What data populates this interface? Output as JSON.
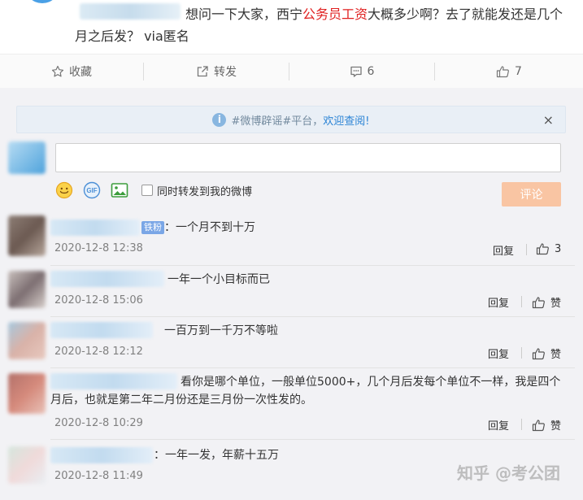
{
  "post": {
    "text_a": "想问一下大家，西宁",
    "text_red": "公务员工资",
    "text_b": "大概多少啊？去了就能发还是几个月之后发？ via匿名"
  },
  "actions": {
    "favorite": "收藏",
    "repost": "转发",
    "comment_count": "6",
    "like_count": "7"
  },
  "notice": {
    "hashtag": "#微博辟谣#平台，",
    "link": "欢迎查阅!",
    "close": "×"
  },
  "composer": {
    "placeholder": "",
    "sync_label": "同时转发到我的微博",
    "submit": "评论"
  },
  "comments": [
    {
      "badge": "铁粉",
      "text": "：一个月不到十万",
      "time": "2020-12-8 12:38",
      "reply": "回复",
      "like": "3"
    },
    {
      "text": "一年一个小目标而已",
      "time": "2020-12-8 15:06",
      "reply": "回复",
      "like": "赞"
    },
    {
      "text": "一百万到一千万不等啦",
      "time": "2020-12-8 12:12",
      "reply": "回复",
      "like": "赞"
    },
    {
      "text": "看你是哪个单位，一般单位5000+，几个月后发每个单位不一样，我是四个月后，也就是第二年二月份还是三月份一次性发的。",
      "time": "2020-12-8 10:29",
      "reply": "回复",
      "like": "赞"
    },
    {
      "text": "：一年一发，年薪十五万",
      "time": "2020-12-8 11:49",
      "reply": "",
      "like": ""
    }
  ],
  "watermark": "知乎 @考公团"
}
